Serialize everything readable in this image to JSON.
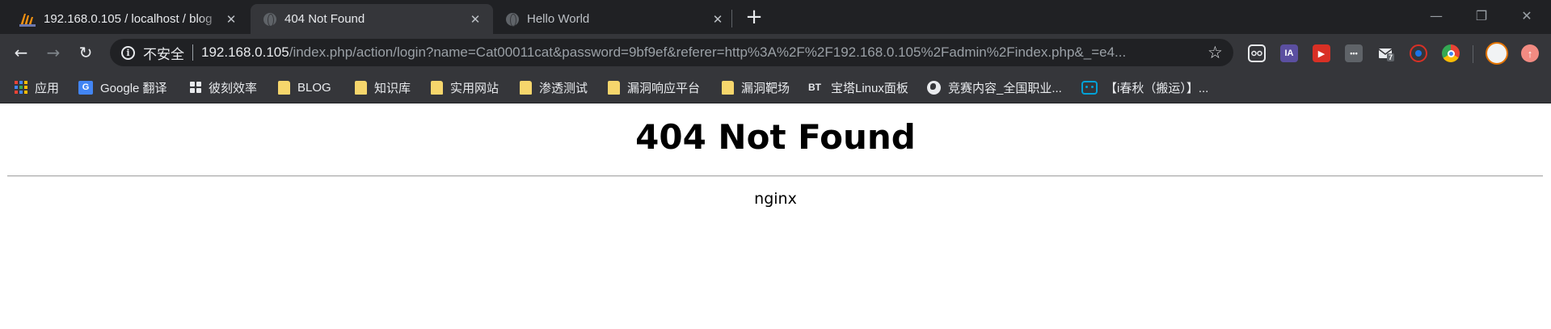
{
  "tabs": [
    {
      "title": "192.168.0.105 / localhost / blog",
      "active": false
    },
    {
      "title": "404 Not Found",
      "active": true
    },
    {
      "title": "Hello World",
      "active": false
    }
  ],
  "toolbar": {
    "security_label": "不安全",
    "url_host": "192.168.0.105",
    "url_rest": "/index.php/action/login?name=Cat00011cat&password=9bf9ef&referer=http%3A%2F%2F192.168.0.105%2Fadmin%2Findex.php&_=e4..."
  },
  "extensions": {
    "ia_label": "IA",
    "more_label": "•••",
    "mail_badge": "7"
  },
  "bookmarks": [
    {
      "label": "应用"
    },
    {
      "label": "Google 翻译"
    },
    {
      "label": "彼刻效率"
    },
    {
      "label": "BLOG"
    },
    {
      "label": "知识库"
    },
    {
      "label": "实用网站"
    },
    {
      "label": "渗透测试"
    },
    {
      "label": "漏洞响应平台"
    },
    {
      "label": "漏洞靶场"
    },
    {
      "label": "宝塔Linux面板",
      "icon_text": "BT"
    },
    {
      "label": "竞赛内容_全国职业..."
    },
    {
      "label": "【i春秋（搬运）】..."
    }
  ],
  "page": {
    "heading": "404 Not Found",
    "server": "nginx"
  },
  "colors": {
    "tabstrip_bg": "#202124",
    "toolbar_bg": "#35363a",
    "omnibox_bg": "#202124",
    "folder": "#f6d66c",
    "page_bg": "#ffffff"
  }
}
